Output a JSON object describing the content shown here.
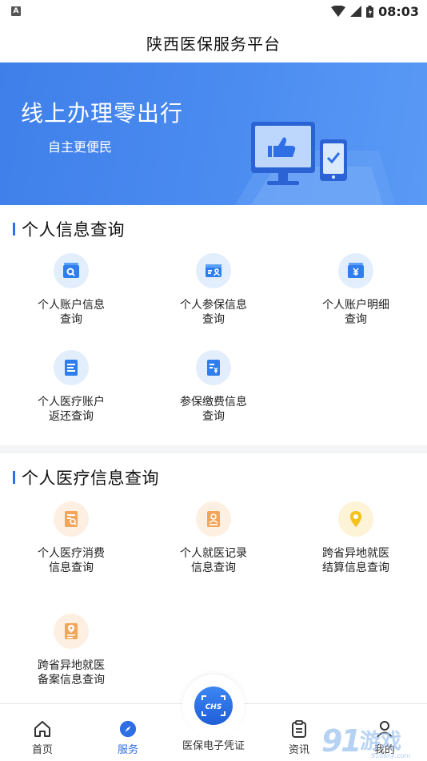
{
  "status": {
    "time": "08:03",
    "indicator": "A"
  },
  "appbar": {
    "title": "陕西医保服务平台"
  },
  "banner": {
    "title": "线上办理零出行",
    "subtitle": "自主更便民"
  },
  "section1": {
    "title": "个人信息查询",
    "items": [
      {
        "label": "个人账户信息查询",
        "icon": "account-search-icon"
      },
      {
        "label": "个人参保信息查询",
        "icon": "insurance-card-icon"
      },
      {
        "label": "个人账户明细查询",
        "icon": "yuan-wallet-icon"
      },
      {
        "label": "个人医疗账户返还查询",
        "icon": "document-list-icon"
      },
      {
        "label": "参保缴费信息查询",
        "icon": "yuan-document-icon"
      }
    ]
  },
  "section2": {
    "title": "个人医疗信息查询",
    "items": [
      {
        "label": "个人医疗消费信息查询",
        "icon": "receipt-search-icon"
      },
      {
        "label": "个人就医记录信息查询",
        "icon": "person-record-icon"
      },
      {
        "label": "跨省异地就医结算信息查询",
        "icon": "location-pin-icon"
      },
      {
        "label": "跨省异地就医备案信息查询",
        "icon": "location-document-icon"
      }
    ]
  },
  "tabbar": {
    "home": "首页",
    "service": "服务",
    "certificate": "医保电子凭证",
    "news": "资讯",
    "mine": "我的",
    "center_badge": "CHS"
  },
  "colors": {
    "accent": "#2f6fe6",
    "banner": "#4b8cf1",
    "orange_icon": "#f0a04b",
    "yellow_icon": "#f5c21b"
  }
}
